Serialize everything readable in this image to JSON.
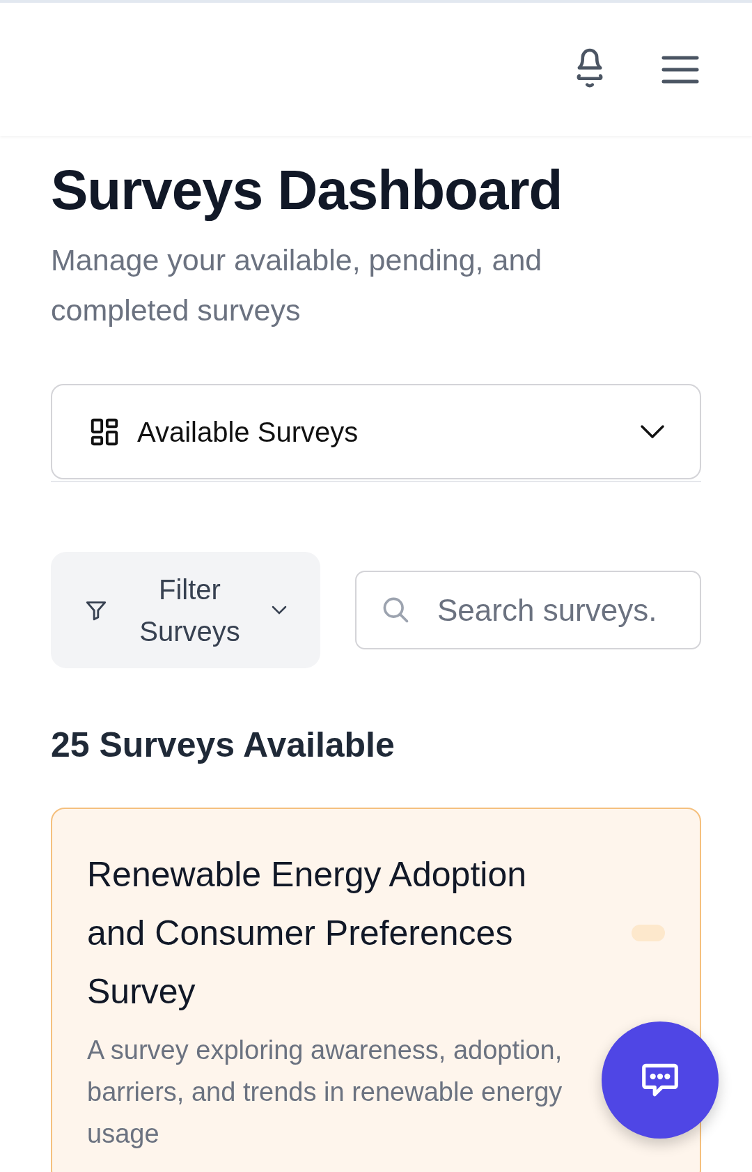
{
  "page_title": "Surveys Dashboard",
  "subtitle": "Manage your available, pending, and completed surveys",
  "view_select": {
    "label": "Available Surveys"
  },
  "filter_button": {
    "label": "Filter Surveys"
  },
  "search": {
    "placeholder": "Search surveys."
  },
  "count_heading": "25 Surveys Available",
  "surveys": [
    {
      "title": "Renewable Energy Adoption and Consumer Preferences Survey",
      "description": "A survey exploring awareness, adoption, barriers, and trends in renewable energy usage",
      "color": "#fde8cc"
    }
  ]
}
